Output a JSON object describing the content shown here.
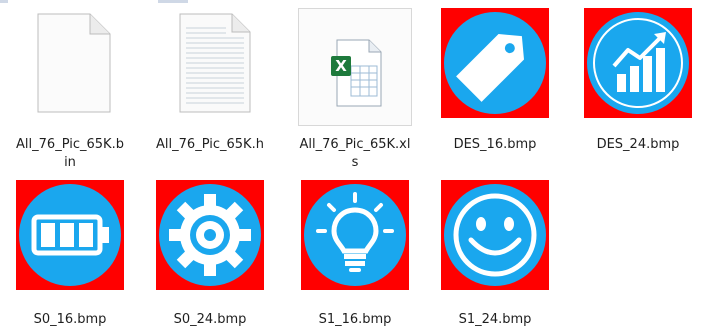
{
  "files": [
    {
      "name": "All_76_Pic_65K.bin",
      "label_line1": "All_76_Pic_65K.b",
      "label_line2": "in",
      "icon": "generic-file-icon"
    },
    {
      "name": "All_76_Pic_65K.h",
      "label_line1": "All_76_Pic_65K.h",
      "label_line2": "",
      "icon": "text-file-icon"
    },
    {
      "name": "All_76_Pic_65K.xls",
      "label_line1": "All_76_Pic_65K.xl",
      "label_line2": "s",
      "icon": "excel-file-icon"
    },
    {
      "name": "DES_16.bmp",
      "label_line1": "DES_16.bmp",
      "label_line2": "",
      "icon": "tag-icon"
    },
    {
      "name": "DES_24.bmp",
      "label_line1": "DES_24.bmp",
      "label_line2": "",
      "icon": "growth-chart-icon"
    },
    {
      "name": "S0_16.bmp",
      "label_line1": "S0_16.bmp",
      "label_line2": "",
      "icon": "battery-icon"
    },
    {
      "name": "S0_24.bmp",
      "label_line1": "S0_24.bmp",
      "label_line2": "",
      "icon": "gear-icon"
    },
    {
      "name": "S1_16.bmp",
      "label_line1": "S1_16.bmp",
      "label_line2": "",
      "icon": "lightbulb-icon"
    },
    {
      "name": "S1_24.bmp",
      "label_line1": "S1_24.bmp",
      "label_line2": "",
      "icon": "smiley-icon"
    }
  ],
  "colors": {
    "bmp_background": "#ff0000",
    "bmp_circle": "#1aa7ee",
    "bmp_glyph": "#ffffff",
    "excel_green": "#1e7a3c"
  }
}
